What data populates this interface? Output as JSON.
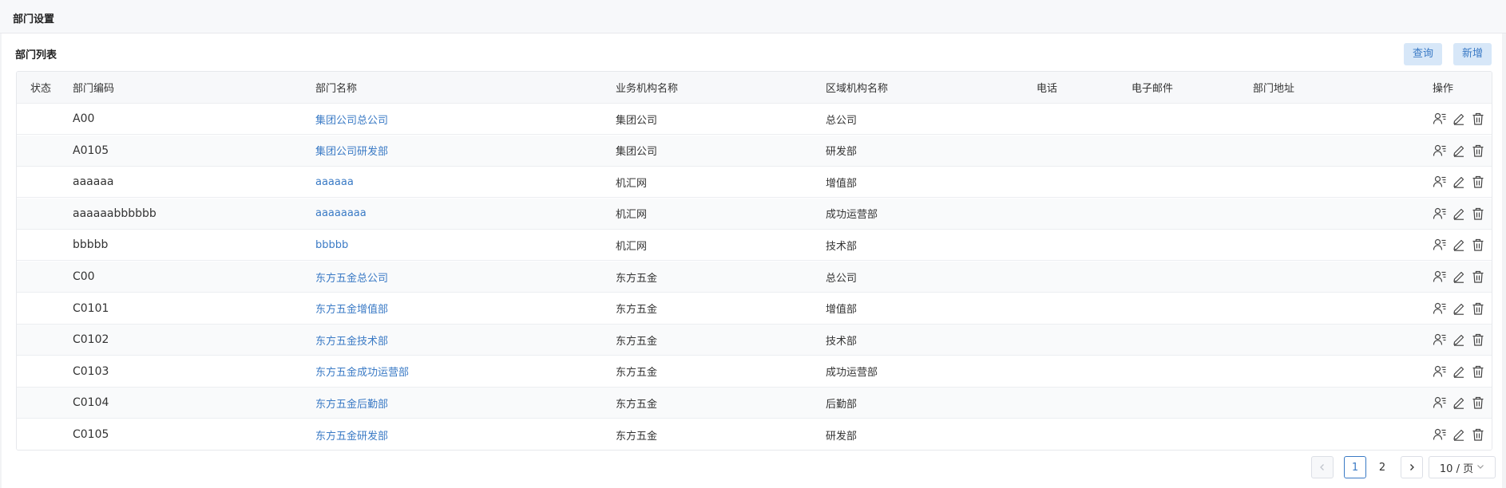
{
  "header": {
    "title": "部门设置"
  },
  "panel": {
    "title": "部门列表",
    "query_label": "查询",
    "add_label": "新增"
  },
  "table": {
    "columns": [
      "状态",
      "部门编码",
      "部门名称",
      "业务机构名称",
      "区域机构名称",
      "电话",
      "电子邮件",
      "部门地址",
      "操作"
    ],
    "rows": [
      {
        "status": "",
        "code": "A00",
        "name": "集团公司总公司",
        "biz_org": "集团公司",
        "area_org": "总公司",
        "phone": "",
        "email": "",
        "address": ""
      },
      {
        "status": "",
        "code": "A0105",
        "name": "集团公司研发部",
        "biz_org": "集团公司",
        "area_org": "研发部",
        "phone": "",
        "email": "",
        "address": ""
      },
      {
        "status": "",
        "code": "aaaaaa",
        "name": "aaaaaa",
        "biz_org": "机汇网",
        "area_org": "增值部",
        "phone": "",
        "email": "",
        "address": ""
      },
      {
        "status": "",
        "code": "aaaaaabbbbbb",
        "name": "aaaaaaaa",
        "biz_org": "机汇网",
        "area_org": "成功运营部",
        "phone": "",
        "email": "",
        "address": ""
      },
      {
        "status": "",
        "code": "bbbbb",
        "name": "bbbbb",
        "biz_org": "机汇网",
        "area_org": "技术部",
        "phone": "",
        "email": "",
        "address": ""
      },
      {
        "status": "",
        "code": "C00",
        "name": "东方五金总公司",
        "biz_org": "东方五金",
        "area_org": "总公司",
        "phone": "",
        "email": "",
        "address": ""
      },
      {
        "status": "",
        "code": "C0101",
        "name": "东方五金增值部",
        "biz_org": "东方五金",
        "area_org": "增值部",
        "phone": "",
        "email": "",
        "address": ""
      },
      {
        "status": "",
        "code": "C0102",
        "name": "东方五金技术部",
        "biz_org": "东方五金",
        "area_org": "技术部",
        "phone": "",
        "email": "",
        "address": ""
      },
      {
        "status": "",
        "code": "C0103",
        "name": "东方五金成功运营部",
        "biz_org": "东方五金",
        "area_org": "成功运营部",
        "phone": "",
        "email": "",
        "address": ""
      },
      {
        "status": "",
        "code": "C0104",
        "name": "东方五金后勤部",
        "biz_org": "东方五金",
        "area_org": "后勤部",
        "phone": "",
        "email": "",
        "address": ""
      },
      {
        "status": "",
        "code": "C0105",
        "name": "东方五金研发部",
        "biz_org": "东方五金",
        "area_org": "研发部",
        "phone": "",
        "email": "",
        "address": ""
      }
    ],
    "row_actions": [
      "user-list-icon",
      "edit-icon",
      "trash-icon"
    ]
  },
  "pagination": {
    "current_page": "1",
    "next_page": "2",
    "page_size": "10 / 页",
    "prev_icon": "chevron-left-icon",
    "next_icon": "chevron-right-icon"
  },
  "colors": {
    "link": "#3a7ac5",
    "button_bg": "#d7e7f8",
    "header_bg": "#f7f8fa"
  }
}
